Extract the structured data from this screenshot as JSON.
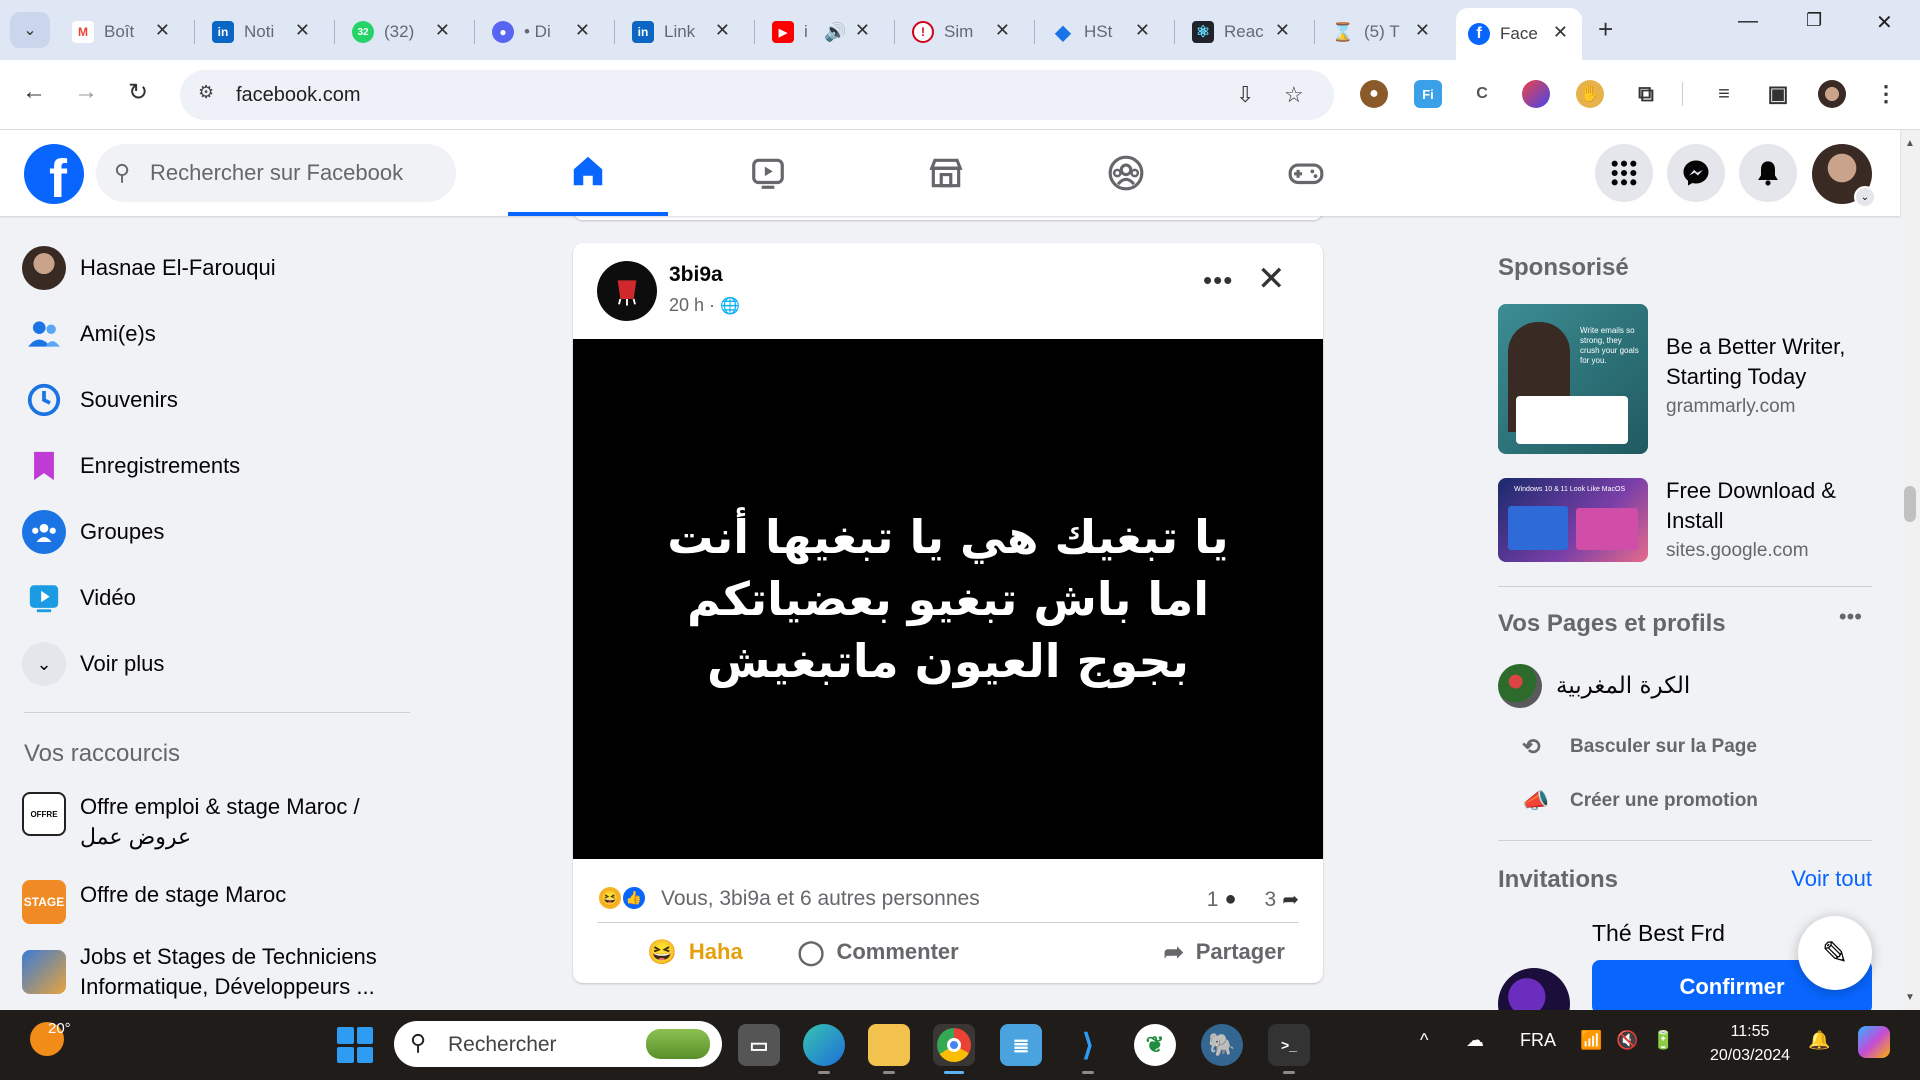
{
  "browser": {
    "tabs": [
      {
        "label": "Boît",
        "icon": "gmail-icon",
        "color": "#ea4335",
        "glyph": "M"
      },
      {
        "label": "Noti",
        "icon": "linkedin-icon",
        "color": "#0a66c2",
        "glyph": "in"
      },
      {
        "label": "(32)",
        "icon": "whatsapp-icon",
        "color": "#25d366",
        "glyph": "32"
      },
      {
        "label": "• Di",
        "icon": "discord-icon",
        "color": "#5865f2",
        "glyph": "●"
      },
      {
        "label": "Link",
        "icon": "linkedin-icon",
        "color": "#0a66c2",
        "glyph": "in"
      },
      {
        "label": "i",
        "icon": "youtube-icon",
        "color": "#ff0000",
        "glyph": "▶"
      },
      {
        "label": "Sim",
        "icon": "simplon-icon",
        "color": "#d0021b",
        "glyph": "!"
      },
      {
        "label": "HSt",
        "icon": "hst-icon",
        "color": "#1a73e8",
        "glyph": "◆"
      },
      {
        "label": "Reac",
        "icon": "react-icon",
        "color": "#20232a",
        "glyph": "⚛"
      },
      {
        "label": "(5) T",
        "icon": "hourglass-icon",
        "color": "#f4b400",
        "glyph": "⌛"
      },
      {
        "label": "Face",
        "icon": "facebook-icon",
        "color": "#0866ff",
        "glyph": "f"
      }
    ],
    "url": "facebook.com"
  },
  "fb": {
    "search_placeholder": "Rechercher sur Facebook",
    "sidebar": {
      "user": "Hasnae El-Farouqui",
      "items": [
        {
          "label": "Ami(e)s",
          "icon": "friends-icon"
        },
        {
          "label": "Souvenirs",
          "icon": "memories-icon"
        },
        {
          "label": "Enregistrements",
          "icon": "saved-icon"
        },
        {
          "label": "Groupes",
          "icon": "groups-icon"
        },
        {
          "label": "Vidéo",
          "icon": "video-icon"
        },
        {
          "label": "Voir plus",
          "icon": "chevron-down-icon"
        }
      ],
      "shortcuts_title": "Vos raccourcis",
      "shortcuts": [
        {
          "label": "Offre emploi & stage Maroc / عروض عمل"
        },
        {
          "label": "Offre de stage Maroc"
        },
        {
          "label": "Jobs et Stages de Techniciens Informatique, Développeurs ..."
        }
      ]
    },
    "post": {
      "author": "3bi9a",
      "time": "20 h ·",
      "quote": "يا تبغيك هي يا تبغيها أنت اما باش تبغيو بعضياتكم بجوج العيون ماتبغيش",
      "reactions_text": "Vous, 3bi9a et 6 autres personnes",
      "comments_count": "1",
      "shares_count": "3",
      "actions": {
        "haha": "Haha",
        "comment": "Commenter",
        "share": "Partager"
      }
    },
    "right": {
      "sponsored_title": "Sponsorisé",
      "ads": [
        {
          "title": "Be a Better Writer, Starting Today",
          "domain": "grammarly.com",
          "thumb_text": "Write emails so strong, they crush your goals for you."
        },
        {
          "title": "Free Download & Install",
          "domain": "sites.google.com",
          "thumb_text": "Windows 10 & 11 Look Like MacOS"
        }
      ],
      "pages_title": "Vos Pages et profils",
      "page_name": "الكرة المغربية",
      "switch_label": "Basculer sur la Page",
      "promo_label": "Créer une promotion",
      "invitations_title": "Invitations",
      "see_all": "Voir tout",
      "invite_name": "Thé Best Frd",
      "confirm_label": "Confirmer"
    }
  },
  "taskbar": {
    "temperature": "20°",
    "search_label": "Rechercher",
    "language": "FRA",
    "time": "11:55",
    "date": "20/03/2024"
  }
}
